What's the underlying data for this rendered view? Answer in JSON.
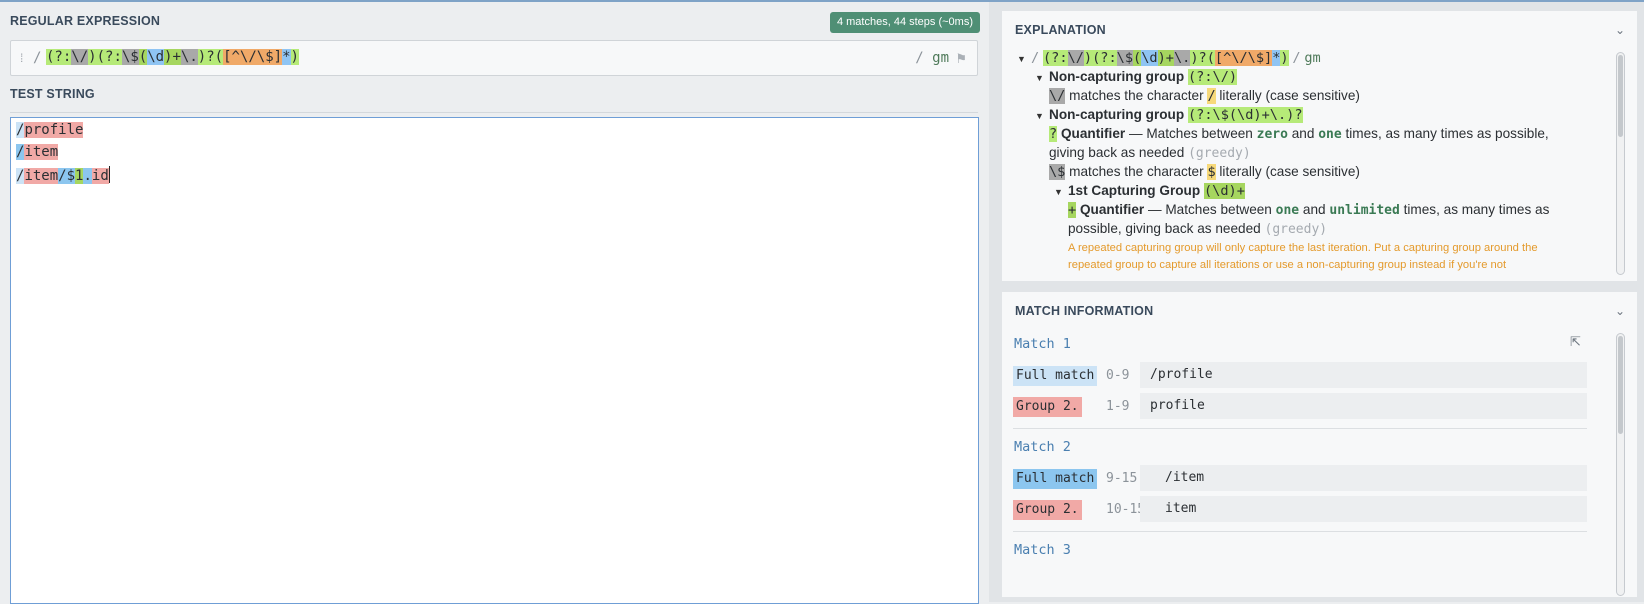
{
  "regex_section": {
    "title": "REGULAR EXPRESSION",
    "badge": "4 matches, 44 steps (~0ms)",
    "delimiter": "/",
    "flags": "gm",
    "tokens": [
      {
        "t": "(?:",
        "c": "g"
      },
      {
        "t": "\\/",
        "c": "dk"
      },
      {
        "t": ")",
        "c": "g"
      },
      {
        "t": "(?:",
        "c": "g"
      },
      {
        "t": "\\$",
        "c": "dk"
      },
      {
        "t": "(",
        "c": "ol"
      },
      {
        "t": "\\d",
        "c": "bl"
      },
      {
        "t": ")+",
        "c": "ol"
      },
      {
        "t": "\\.",
        "c": "dk"
      },
      {
        "t": ")?",
        "c": "g"
      },
      {
        "t": "(",
        "c": "g"
      },
      {
        "t": "[^\\/\\$]",
        "c": "or"
      },
      {
        "t": "*",
        "c": "bl"
      },
      {
        "t": ")",
        "c": "g"
      }
    ]
  },
  "test_section": {
    "title": "TEST STRING",
    "lines": [
      [
        {
          "t": "/",
          "c": "lb"
        },
        {
          "t": "profile",
          "c": "rd"
        }
      ],
      [
        {
          "t": "/",
          "c": "bm"
        },
        {
          "t": "item",
          "c": "rd"
        }
      ],
      [
        {
          "t": "/",
          "c": "lb"
        },
        {
          "t": "item",
          "c": "rd"
        },
        {
          "t": "/$",
          "c": "bm"
        },
        {
          "t": "1",
          "c": "ol"
        },
        {
          "t": ".",
          "c": "bm"
        },
        {
          "t": "id",
          "c": "rd"
        }
      ]
    ]
  },
  "explanation": {
    "title": "EXPLANATION",
    "root_flags": "gm",
    "ncg1": {
      "label": "Non-capturing group",
      "token": "(?:\\/)"
    },
    "slash_literal": {
      "token": "\\/",
      "text_a": "matches the character",
      "char": "/",
      "text_b": "literally (case sensitive)"
    },
    "ncg2": {
      "label": "Non-capturing group",
      "token": "(?:\\$(\\d)+\\.)?"
    },
    "q1": {
      "token": "?",
      "label": "Quantifier",
      "text_a": "— Matches between",
      "kw1": "zero",
      "text_and": "and",
      "kw2": "one",
      "text_b": "times, as many times as possible,",
      "text_c": "giving back as needed",
      "greedy": "(greedy)"
    },
    "dollar_literal": {
      "token": "\\$",
      "text_a": "matches the character",
      "char": "$",
      "text_b": "literally (case sensitive)"
    },
    "cg1": {
      "label": "1st Capturing Group",
      "token": "(\\d)+"
    },
    "q2": {
      "token": "+",
      "label": "Quantifier",
      "text_a": "— Matches between",
      "kw1": "one",
      "text_and": "and",
      "kw2": "unlimited",
      "text_b": "times, as many times as",
      "text_c": "possible, giving back as needed",
      "greedy": "(greedy)"
    },
    "warning_1": "A repeated capturing group will only capture the last iteration. Put a capturing group around the",
    "warning_2": "repeated group to capture all iterations or use a non-capturing group instead if you're not"
  },
  "match_info": {
    "title": "MATCH INFORMATION",
    "matches": [
      {
        "title": "Match 1",
        "rows": [
          {
            "label": "Full match",
            "range": "0-9",
            "value": "/profile",
            "color": "#cce3f6"
          },
          {
            "label": "Group 2.",
            "range": "1-9",
            "value": "profile",
            "color": "#f1a9a6"
          }
        ]
      },
      {
        "title": "Match 2",
        "rows": [
          {
            "label": "Full match",
            "range": "9-15",
            "value": "/item",
            "color": "#8cc6ef"
          },
          {
            "label": "Group 2.",
            "range": "10-15",
            "value": "item",
            "color": "#f1a9a6"
          }
        ]
      },
      {
        "title": "Match 3",
        "rows": []
      }
    ]
  },
  "colors": {
    "badge": "#4f8f75",
    "accent": "#4a7fb0",
    "warning": "#e49a2c"
  }
}
